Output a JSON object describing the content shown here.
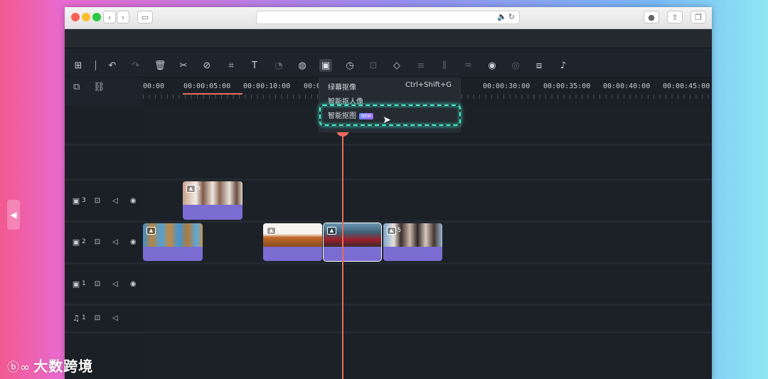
{
  "browser": {
    "url_icons": [
      "speaker-icon",
      "reload-icon"
    ]
  },
  "toolbar": {
    "icons": [
      "layout-icon",
      "undo-icon",
      "redo-icon",
      "delete-icon",
      "cut-icon",
      "disable-icon",
      "crop-icon",
      "text-icon",
      "speed-icon",
      "color-icon",
      "smart-cutout-icon",
      "timer-icon",
      "freeze-icon",
      "mask-icon",
      "adjust-icon",
      "audio-split-icon",
      "silence-icon",
      "motion-icon",
      "speed-ramp-icon",
      "snapshot-icon",
      "audio-icon"
    ]
  },
  "dropdown": {
    "items": [
      {
        "label": "绿幕抠像",
        "shortcut": "Ctrl+Shift+G"
      },
      {
        "label": "智能抠人像"
      },
      {
        "label": "智能抠图",
        "badge": "NEW"
      }
    ]
  },
  "ruler": {
    "labels": [
      "00:00",
      "00:00:05:00",
      "00:00:10:00",
      "00:0",
      "00:00:30:00",
      "00:00:35:00",
      "00:00:40:00",
      "00:00:45:00"
    ]
  },
  "tracks": [
    {
      "kind": "video",
      "number": "3",
      "clips": [
        {
          "num": "5"
        }
      ]
    },
    {
      "kind": "video",
      "number": "2",
      "clips": [
        {
          "num": ""
        },
        {
          "num": "5"
        },
        {
          "num": ""
        },
        {
          "num": "5"
        }
      ]
    },
    {
      "kind": "video",
      "number": "1",
      "clips": []
    },
    {
      "kind": "audio",
      "number": "1",
      "clips": []
    }
  ],
  "watermark": {
    "logo": "ⓑ∞",
    "text": "大数跨境"
  },
  "colors": {
    "accent_purple": "#7a6cd1",
    "playhead": "#e96b5f",
    "highlight": "#4de3c4",
    "panel": "#1e242c"
  }
}
